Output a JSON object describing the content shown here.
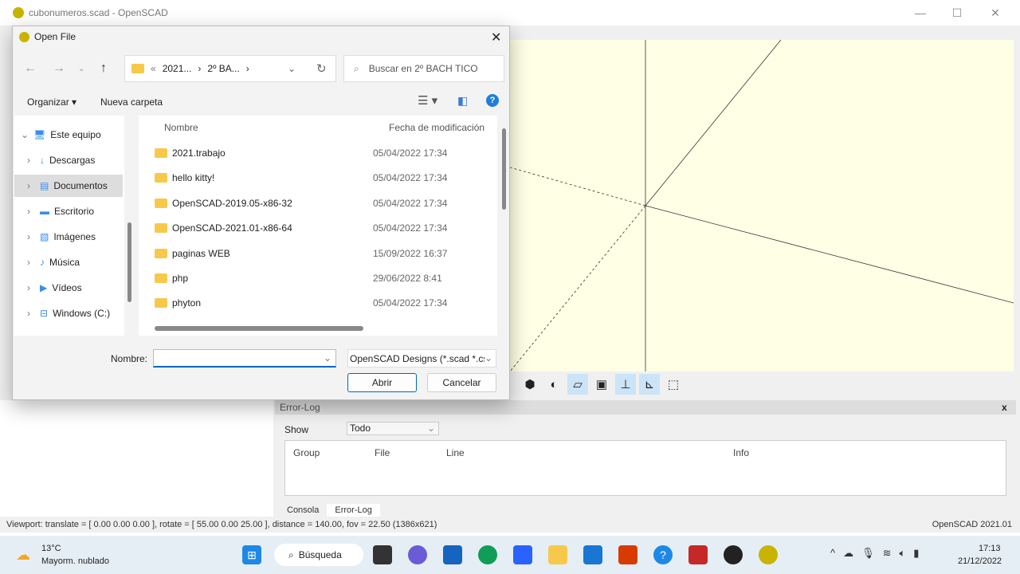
{
  "app": {
    "title": "cubonumeros.scad - OpenSCAD",
    "min": "—",
    "max": "☐",
    "close": "✕"
  },
  "dialog": {
    "title": "Open File",
    "close": "✕",
    "breadcrumb": [
      "«",
      "2021...",
      "›",
      "2º BA...",
      "›"
    ],
    "search_placeholder": "Buscar en 2º BACH TICO",
    "organize": "Organizar ▾",
    "new_folder": "Nueva carpeta",
    "nav": [
      {
        "label": "Este equipo",
        "icon": "computer-icon"
      },
      {
        "label": "Descargas",
        "icon": "download-icon"
      },
      {
        "label": "Documentos",
        "icon": "documents-icon"
      },
      {
        "label": "Escritorio",
        "icon": "desktop-icon"
      },
      {
        "label": "Imágenes",
        "icon": "pictures-icon"
      },
      {
        "label": "Música",
        "icon": "music-icon"
      },
      {
        "label": "Vídeos",
        "icon": "videos-icon"
      },
      {
        "label": "Windows (C:)",
        "icon": "drive-icon"
      }
    ],
    "columns": {
      "name": "Nombre",
      "date": "Fecha de modificación"
    },
    "files": [
      {
        "name": "2021.trabajo",
        "date": "05/04/2022 17:34"
      },
      {
        "name": "hello kitty!",
        "date": "05/04/2022 17:34"
      },
      {
        "name": "OpenSCAD-2019.05-x86-32",
        "date": "05/04/2022 17:34"
      },
      {
        "name": "OpenSCAD-2021.01-x86-64",
        "date": "05/04/2022 17:34"
      },
      {
        "name": "paginas WEB",
        "date": "15/09/2022 16:37"
      },
      {
        "name": "php",
        "date": "29/06/2022 8:41"
      },
      {
        "name": "phyton",
        "date": "05/04/2022 17:34"
      }
    ],
    "filename_label": "Nombre:",
    "filename_value": "",
    "filetype": "OpenSCAD Designs (*.scad *.cs",
    "open": "Abrir",
    "cancel": "Cancelar"
  },
  "errorlog": {
    "title": "Error-Log",
    "close": "x",
    "show_label": "Show",
    "show_value": "Todo",
    "cols": [
      "Group",
      "File",
      "Line",
      "Info"
    ]
  },
  "tabs": [
    "Consola",
    "Error-Log"
  ],
  "status": {
    "left": "Viewport: translate = [ 0.00 0.00 0.00 ], rotate = [ 55.00 0.00 25.00 ], distance = 140.00, fov = 22.50 (1386x621)",
    "right": "OpenSCAD 2021.01"
  },
  "taskbar": {
    "temp": "13°C",
    "weather": "Mayorm. nublado",
    "search": "Búsqueda",
    "time": "17:13",
    "date": "21/12/2022"
  }
}
